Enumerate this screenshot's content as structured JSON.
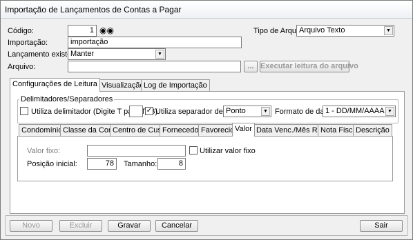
{
  "window": {
    "title": "Importação de Lançamentos de Contas a Pagar"
  },
  "form": {
    "codigo_label": "Código:",
    "codigo_value": "1",
    "importacao_label": "Importação:",
    "importacao_value": "importação",
    "lancamento_label": "Lançamento existente:",
    "lancamento_value": "Manter",
    "arquivo_label": "Arquivo:",
    "arquivo_value": "",
    "browse_label": "...",
    "executar_label": "Executar leitura do arquivo",
    "tipo_label": "Tipo de Arquivo:",
    "tipo_value": "Arquivo Texto"
  },
  "main_tabs": [
    {
      "label": "Configurações de Leitura",
      "active": true
    },
    {
      "label": "Visualização",
      "active": false
    },
    {
      "label": "Log de Importação",
      "active": false
    }
  ],
  "delimiters": {
    "group_title": "Delimitadores/Separadores",
    "utiliza_delimitador_label": "Utiliza delimitador (Digite T para TAB)",
    "utiliza_delimitador_checked": false,
    "delimitador_value": "",
    "utiliza_separador_label": "Utiliza separador decimal",
    "utiliza_separador_checked": true,
    "separador_value": "Ponto",
    "formato_label": "Formato de data:",
    "formato_value": "1 - DD/MM/AAAA"
  },
  "sub_tabs": [
    {
      "label": "Condomínios",
      "active": false
    },
    {
      "label": "Classe da Conta",
      "active": false
    },
    {
      "label": "Centro de Custos",
      "active": false
    },
    {
      "label": "Fornecedor",
      "active": false
    },
    {
      "label": "Favorecido",
      "active": false
    },
    {
      "label": "Valor",
      "active": true
    },
    {
      "label": "Data Venc./Mês Ref.",
      "active": false
    },
    {
      "label": "Nota Fiscal",
      "active": false
    },
    {
      "label": "Descrição",
      "active": false
    }
  ],
  "valor": {
    "valor_fixo_label": "Valor fixo:",
    "valor_fixo_value": "",
    "utilizar_valor_fixo_label": "Utilizar valor fixo",
    "utilizar_valor_fixo_checked": false,
    "posicao_label": "Posição inicial:",
    "posicao_value": "78",
    "tamanho_label": "Tamanho:",
    "tamanho_value": "8"
  },
  "buttons": {
    "novo": "Novo",
    "excluir": "Excluir",
    "gravar": "Gravar",
    "cancelar": "Cancelar",
    "sair": "Sair"
  }
}
